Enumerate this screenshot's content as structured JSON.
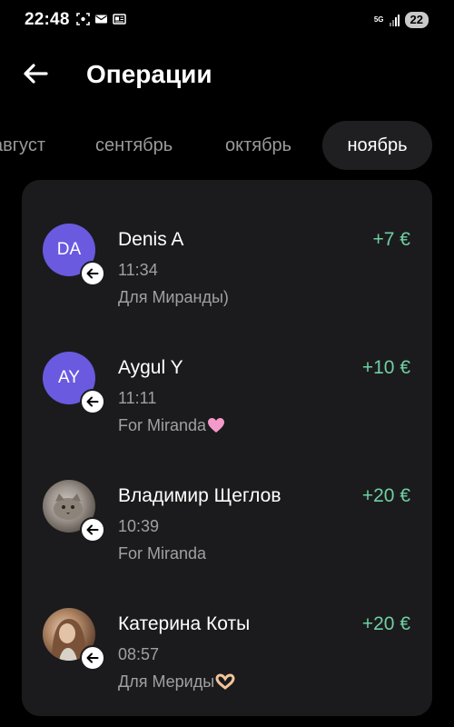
{
  "status_bar": {
    "time": "22:48",
    "network": "5G",
    "battery": "22"
  },
  "header": {
    "title": "Операции"
  },
  "tabs": [
    {
      "label": "август",
      "selected": false
    },
    {
      "label": "сентябрь",
      "selected": false
    },
    {
      "label": "октябрь",
      "selected": false
    },
    {
      "label": "ноябрь",
      "selected": true
    }
  ],
  "operations": [
    {
      "initials": "DA",
      "name": "Denis A",
      "time": "11:34",
      "note": "Для Миранды)",
      "amount": "+7 €",
      "avatar": "initials"
    },
    {
      "initials": "AY",
      "name": "Aygul Y",
      "time": "11:11",
      "note": "For Miranda",
      "note_emoji": "pink-heart",
      "amount": "+10 €",
      "avatar": "initials"
    },
    {
      "initials": "",
      "name": "Владимир Щеглов",
      "time": "10:39",
      "note": "For Miranda",
      "amount": "+20 €",
      "avatar": "photo-cat"
    },
    {
      "initials": "",
      "name": "Катерина Коты",
      "time": "08:57",
      "note": "Для Мериды",
      "note_emoji": "heart-hands",
      "amount": "+20 €",
      "avatar": "photo-girl"
    }
  ],
  "colors": {
    "accent_amount": "#6fcfa3",
    "avatar_initials_bg": "#6a5ae0",
    "card_bg": "#1b1b1d",
    "selected_tab_bg": "#1f1f22"
  }
}
